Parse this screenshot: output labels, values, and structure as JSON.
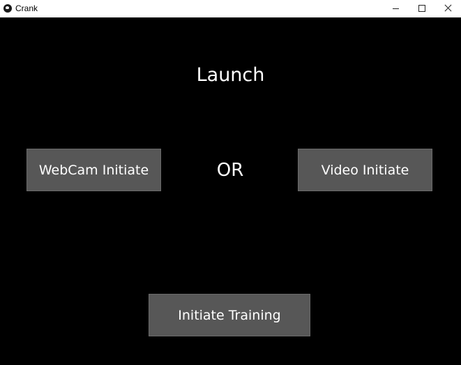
{
  "window": {
    "title": "Crank",
    "icon": "crank-app-icon",
    "controls": {
      "minimize_icon": "minimize-icon",
      "maximize_icon": "maximize-icon",
      "close_icon": "close-icon"
    }
  },
  "main": {
    "heading": "Launch",
    "separator": "OR",
    "webcam_button": "WebCam Initiate",
    "video_button": "Video Initiate",
    "training_button": "Initiate Training"
  },
  "colors": {
    "background": "#000000",
    "button": "#575757",
    "text": "#ffffff",
    "titlebar": "#ffffff"
  }
}
